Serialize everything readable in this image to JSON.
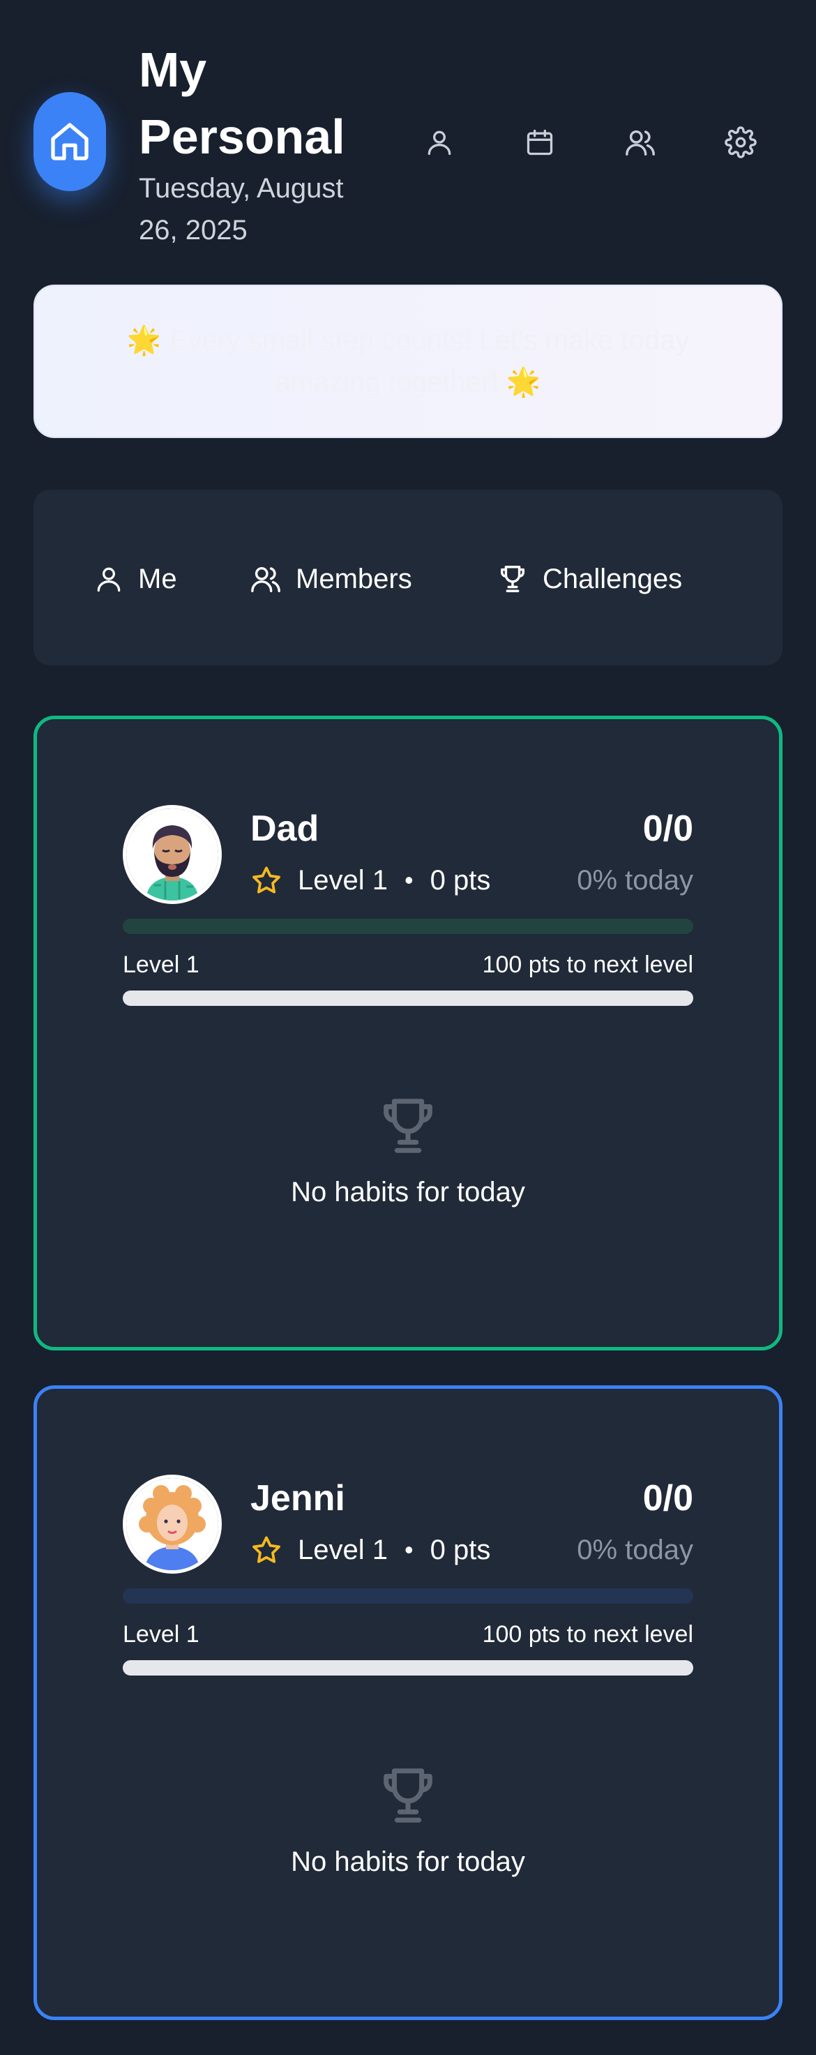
{
  "header": {
    "title": "My Personal",
    "date": "Tuesday, August 26, 2025",
    "icons": [
      "home-icon",
      "user-icon",
      "calendar-icon",
      "users-icon",
      "settings-icon"
    ]
  },
  "banner": {
    "text": "🌟 Every small step counts! Let's make today amazing together! 🌟"
  },
  "tabs": [
    {
      "label": "Me",
      "icon": "user-icon"
    },
    {
      "label": "Members",
      "icon": "users-icon"
    },
    {
      "label": "Challenges",
      "icon": "trophy-icon"
    }
  ],
  "members": [
    {
      "name": "Dad",
      "level": "Level 1",
      "separator": "•",
      "points": "0 pts",
      "score": "0/0",
      "percent": "0% today",
      "daily_progress": 0,
      "level_label": "Level 1",
      "next_level": "100 pts to next level",
      "xp_progress": 0,
      "empty_text": "No habits for today",
      "accent": "#10b981"
    },
    {
      "name": "Jenni",
      "level": "Level 1",
      "separator": "•",
      "points": "0 pts",
      "score": "0/0",
      "percent": "0% today",
      "daily_progress": 0,
      "level_label": "Level 1",
      "next_level": "100 pts to next level",
      "xp_progress": 0,
      "empty_text": "No habits for today",
      "accent": "#3b82f6"
    }
  ]
}
